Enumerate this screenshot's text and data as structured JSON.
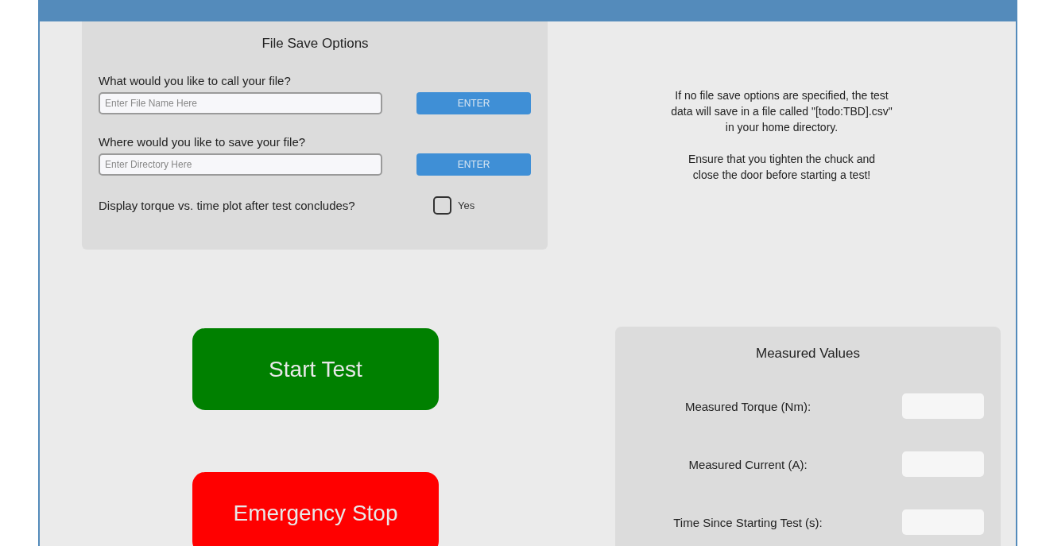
{
  "file_save_options": {
    "title": "File Save Options",
    "fields": [
      {
        "label": "What would you like to call your file?",
        "placeholder": "Enter File Name Here",
        "button": "ENTER"
      },
      {
        "label": "Where would you like to save your file?",
        "placeholder": "Enter Directory Here",
        "button": "ENTER"
      }
    ],
    "plot_option": {
      "label": "Display torque vs. time plot after test concludes?",
      "checked": false,
      "option_label": "Yes"
    }
  },
  "notes": [
    {
      "lines": [
        "If no file save options are specified, the test",
        "data will save in a file called \"[todo:TBD].csv\"",
        "in your home directory."
      ]
    },
    {
      "lines": [
        "Ensure that you tighten the chuck and",
        "close the door before starting a test!"
      ]
    }
  ],
  "actions": [
    {
      "kind": "start",
      "label": "Start Test"
    },
    {
      "kind": "stop",
      "label": "Emergency Stop"
    }
  ],
  "measured_values": {
    "title": "Measured Values",
    "rows": [
      {
        "label": "Measured Torque (Nm):"
      },
      {
        "label": "Measured Current (A):"
      },
      {
        "label": "Time Since Starting Test (s):"
      }
    ]
  }
}
